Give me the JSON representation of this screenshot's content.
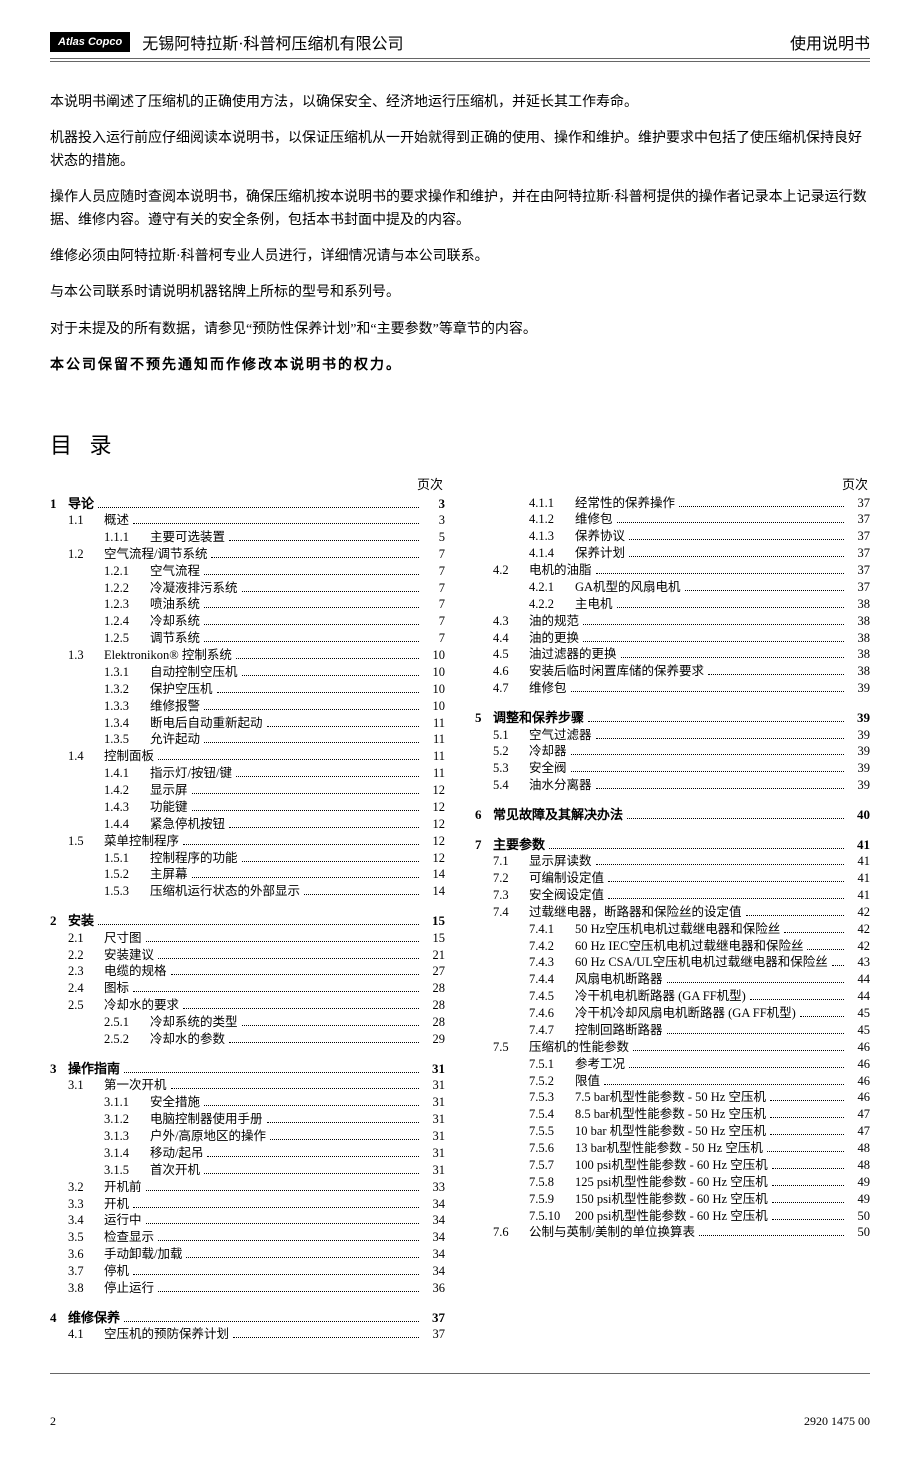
{
  "logo": "Atlas Copco",
  "header_company": "无锡阿特拉斯·科普柯压缩机有限公司",
  "header_doc": "使用说明书",
  "intro": [
    "本说明书阐述了压缩机的正确使用方法，以确保安全、经济地运行压缩机，并延长其工作寿命。",
    "机器投入运行前应仔细阅读本说明书，以保证压缩机从一开始就得到正确的使用、操作和维护。维护要求中包括了使压缩机保持良好状态的措施。",
    "操作人员应随时查阅本说明书，确保压缩机按本说明书的要求操作和维护，并在由阿特拉斯·科普柯提供的操作者记录本上记录运行数据、维修内容。遵守有关的安全条例，包括本书封面中提及的内容。",
    "维修必须由阿特拉斯·科普柯专业人员进行，详细情况请与本公司联系。",
    "与本公司联系时请说明机器铭牌上所标的型号和系列号。",
    "对于未提及的所有数据，请参见“预防性保养计划”和“主要参数”等章节的内容。"
  ],
  "intro_bold": "本公司保留不预先通知而作修改本说明书的权力。",
  "toc_title": "目 录",
  "page_label": "页次",
  "toc_left": [
    {
      "lvl": 1,
      "num": "1",
      "text": "导论",
      "page": "3"
    },
    {
      "lvl": 2,
      "num": "1.1",
      "text": "概述",
      "page": "3"
    },
    {
      "lvl": 3,
      "num": "1.1.1",
      "text": "主要可选装置",
      "page": "5"
    },
    {
      "lvl": 2,
      "num": "1.2",
      "text": "空气流程/调节系统",
      "page": "7"
    },
    {
      "lvl": 3,
      "num": "1.2.1",
      "text": "空气流程",
      "page": "7"
    },
    {
      "lvl": 3,
      "num": "1.2.2",
      "text": "冷凝液排污系统",
      "page": "7"
    },
    {
      "lvl": 3,
      "num": "1.2.3",
      "text": "喷油系统",
      "page": "7"
    },
    {
      "lvl": 3,
      "num": "1.2.4",
      "text": "冷却系统",
      "page": "7"
    },
    {
      "lvl": 3,
      "num": "1.2.5",
      "text": "调节系统",
      "page": "7"
    },
    {
      "lvl": 2,
      "num": "1.3",
      "text": "Elektronikon® 控制系统",
      "page": "10"
    },
    {
      "lvl": 3,
      "num": "1.3.1",
      "text": "自动控制空压机",
      "page": "10"
    },
    {
      "lvl": 3,
      "num": "1.3.2",
      "text": "保护空压机",
      "page": "10"
    },
    {
      "lvl": 3,
      "num": "1.3.3",
      "text": "维修报警",
      "page": "10"
    },
    {
      "lvl": 3,
      "num": "1.3.4",
      "text": "断电后自动重新起动",
      "page": "11"
    },
    {
      "lvl": 3,
      "num": "1.3.5",
      "text": "允许起动",
      "page": "11"
    },
    {
      "lvl": 2,
      "num": "1.4",
      "text": "控制面板",
      "page": "11"
    },
    {
      "lvl": 3,
      "num": "1.4.1",
      "text": "指示灯/按钮/键",
      "page": "11"
    },
    {
      "lvl": 3,
      "num": "1.4.2",
      "text": "显示屏",
      "page": "12"
    },
    {
      "lvl": 3,
      "num": "1.4.3",
      "text": "功能键",
      "page": "12"
    },
    {
      "lvl": 3,
      "num": "1.4.4",
      "text": "紧急停机按钮",
      "page": "12"
    },
    {
      "lvl": 2,
      "num": "1.5",
      "text": "菜单控制程序",
      "page": "12"
    },
    {
      "lvl": 3,
      "num": "1.5.1",
      "text": "控制程序的功能",
      "page": "12"
    },
    {
      "lvl": 3,
      "num": "1.5.2",
      "text": "主屏幕",
      "page": "14"
    },
    {
      "lvl": 3,
      "num": "1.5.3",
      "text": "压缩机运行状态的外部显示",
      "page": "14"
    },
    {
      "lvl": 1,
      "num": "2",
      "text": "安装",
      "page": "15"
    },
    {
      "lvl": 2,
      "num": "2.1",
      "text": "尺寸图",
      "page": "15"
    },
    {
      "lvl": 2,
      "num": "2.2",
      "text": "安装建议",
      "page": "21"
    },
    {
      "lvl": 2,
      "num": "2.3",
      "text": "电缆的规格",
      "page": "27"
    },
    {
      "lvl": 2,
      "num": "2.4",
      "text": "图标",
      "page": "28"
    },
    {
      "lvl": 2,
      "num": "2.5",
      "text": "冷却水的要求",
      "page": "28"
    },
    {
      "lvl": 3,
      "num": "2.5.1",
      "text": "冷却系统的类型",
      "page": "28"
    },
    {
      "lvl": 3,
      "num": "2.5.2",
      "text": "冷却水的参数",
      "page": "29"
    },
    {
      "lvl": 1,
      "num": "3",
      "text": "操作指南",
      "page": "31"
    },
    {
      "lvl": 2,
      "num": "3.1",
      "text": "第一次开机",
      "page": "31"
    },
    {
      "lvl": 3,
      "num": "3.1.1",
      "text": "安全措施",
      "page": "31"
    },
    {
      "lvl": 3,
      "num": "3.1.2",
      "text": "电脑控制器使用手册",
      "page": "31"
    },
    {
      "lvl": 3,
      "num": "3.1.3",
      "text": "户外/高原地区的操作",
      "page": "31"
    },
    {
      "lvl": 3,
      "num": "3.1.4",
      "text": "移动/起吊",
      "page": "31"
    },
    {
      "lvl": 3,
      "num": "3.1.5",
      "text": "首次开机",
      "page": "31"
    },
    {
      "lvl": 2,
      "num": "3.2",
      "text": "开机前",
      "page": "33"
    },
    {
      "lvl": 2,
      "num": "3.3",
      "text": "开机",
      "page": "34"
    },
    {
      "lvl": 2,
      "num": "3.4",
      "text": "运行中",
      "page": "34"
    },
    {
      "lvl": 2,
      "num": "3.5",
      "text": "检查显示",
      "page": "34"
    },
    {
      "lvl": 2,
      "num": "3.6",
      "text": "手动卸载/加载",
      "page": "34"
    },
    {
      "lvl": 2,
      "num": "3.7",
      "text": "停机",
      "page": "34"
    },
    {
      "lvl": 2,
      "num": "3.8",
      "text": "停止运行",
      "page": "36"
    },
    {
      "lvl": 1,
      "num": "4",
      "text": "维修保养",
      "page": "37"
    },
    {
      "lvl": 2,
      "num": "4.1",
      "text": "空压机的预防保养计划",
      "page": "37"
    }
  ],
  "toc_right": [
    {
      "lvl": 3,
      "num": "4.1.1",
      "text": "经常性的保养操作",
      "page": "37"
    },
    {
      "lvl": 3,
      "num": "4.1.2",
      "text": "维修包",
      "page": "37"
    },
    {
      "lvl": 3,
      "num": "4.1.3",
      "text": "保养协议",
      "page": "37"
    },
    {
      "lvl": 3,
      "num": "4.1.4",
      "text": "保养计划",
      "page": "37"
    },
    {
      "lvl": 2,
      "num": "4.2",
      "text": "电机的油脂",
      "page": "37"
    },
    {
      "lvl": 3,
      "num": "4.2.1",
      "text": "GA机型的风扇电机",
      "page": "37"
    },
    {
      "lvl": 3,
      "num": "4.2.2",
      "text": "主电机",
      "page": "38"
    },
    {
      "lvl": 2,
      "num": "4.3",
      "text": "油的规范",
      "page": "38"
    },
    {
      "lvl": 2,
      "num": "4.4",
      "text": "油的更换",
      "page": "38"
    },
    {
      "lvl": 2,
      "num": "4.5",
      "text": "油过滤器的更换",
      "page": "38"
    },
    {
      "lvl": 2,
      "num": "4.6",
      "text": "安装后临时闲置库储的保养要求",
      "page": "38"
    },
    {
      "lvl": 2,
      "num": "4.7",
      "text": "维修包",
      "page": "39"
    },
    {
      "lvl": 1,
      "num": "5",
      "text": "调整和保养步骤",
      "page": "39"
    },
    {
      "lvl": 2,
      "num": "5.1",
      "text": "空气过滤器",
      "page": "39"
    },
    {
      "lvl": 2,
      "num": "5.2",
      "text": "冷却器",
      "page": "39"
    },
    {
      "lvl": 2,
      "num": "5.3",
      "text": "安全阀",
      "page": "39"
    },
    {
      "lvl": 2,
      "num": "5.4",
      "text": "油水分离器",
      "page": "39"
    },
    {
      "lvl": 1,
      "num": "6",
      "text": "常见故障及其解决办法",
      "page": "40"
    },
    {
      "lvl": 1,
      "num": "7",
      "text": "主要参数",
      "page": "41"
    },
    {
      "lvl": 2,
      "num": "7.1",
      "text": "显示屏读数",
      "page": "41"
    },
    {
      "lvl": 2,
      "num": "7.2",
      "text": "可编制设定值",
      "page": "41"
    },
    {
      "lvl": 2,
      "num": "7.3",
      "text": "安全阀设定值",
      "page": "41"
    },
    {
      "lvl": 2,
      "num": "7.4",
      "text": "过载继电器，断路器和保险丝的设定值",
      "page": "42"
    },
    {
      "lvl": 3,
      "num": "7.4.1",
      "text": "50 Hz空压机电机过载继电器和保险丝",
      "page": "42"
    },
    {
      "lvl": 3,
      "num": "7.4.2",
      "text": "60 Hz IEC空压机电机过载继电器和保险丝",
      "page": "42"
    },
    {
      "lvl": 3,
      "num": "7.4.3",
      "text": "60 Hz CSA/UL空压机电机过载继电器和保险丝",
      "page": "43"
    },
    {
      "lvl": 3,
      "num": "7.4.4",
      "text": "风扇电机断路器",
      "page": "44"
    },
    {
      "lvl": 3,
      "num": "7.4.5",
      "text": "冷干机电机断路器 (GA FF机型)",
      "page": "44"
    },
    {
      "lvl": 3,
      "num": "7.4.6",
      "text": "冷干机冷却风扇电机断路器 (GA FF机型)",
      "page": "45"
    },
    {
      "lvl": 3,
      "num": "7.4.7",
      "text": "控制回路断路器",
      "page": "45"
    },
    {
      "lvl": 2,
      "num": "7.5",
      "text": "压缩机的性能参数",
      "page": "46"
    },
    {
      "lvl": 3,
      "num": "7.5.1",
      "text": "参考工况",
      "page": "46"
    },
    {
      "lvl": 3,
      "num": "7.5.2",
      "text": "限值",
      "page": "46"
    },
    {
      "lvl": 3,
      "num": "7.5.3",
      "text": "7.5 bar机型性能参数 - 50 Hz 空压机",
      "page": "46"
    },
    {
      "lvl": 3,
      "num": "7.5.4",
      "text": "8.5 bar机型性能参数 - 50 Hz 空压机",
      "page": "47"
    },
    {
      "lvl": 3,
      "num": "7.5.5",
      "text": "10 bar 机型性能参数 - 50 Hz 空压机",
      "page": "47"
    },
    {
      "lvl": 3,
      "num": "7.5.6",
      "text": "13 bar机型性能参数 - 50 Hz 空压机",
      "page": "48"
    },
    {
      "lvl": 3,
      "num": "7.5.7",
      "text": "100 psi机型性能参数 - 60 Hz 空压机",
      "page": "48"
    },
    {
      "lvl": 3,
      "num": "7.5.8",
      "text": "125 psi机型性能参数 - 60 Hz 空压机",
      "page": "49"
    },
    {
      "lvl": 3,
      "num": "7.5.9",
      "text": "150 psi机型性能参数 - 60 Hz 空压机",
      "page": "49"
    },
    {
      "lvl": 3,
      "num": "7.5.10",
      "text": "200 psi机型性能参数 - 60 Hz 空压机",
      "page": "50"
    },
    {
      "lvl": 2,
      "num": "7.6",
      "text": "公制与英制/美制的单位换算表",
      "page": "50"
    }
  ],
  "footer_left": "2",
  "footer_right": "2920 1475 00"
}
